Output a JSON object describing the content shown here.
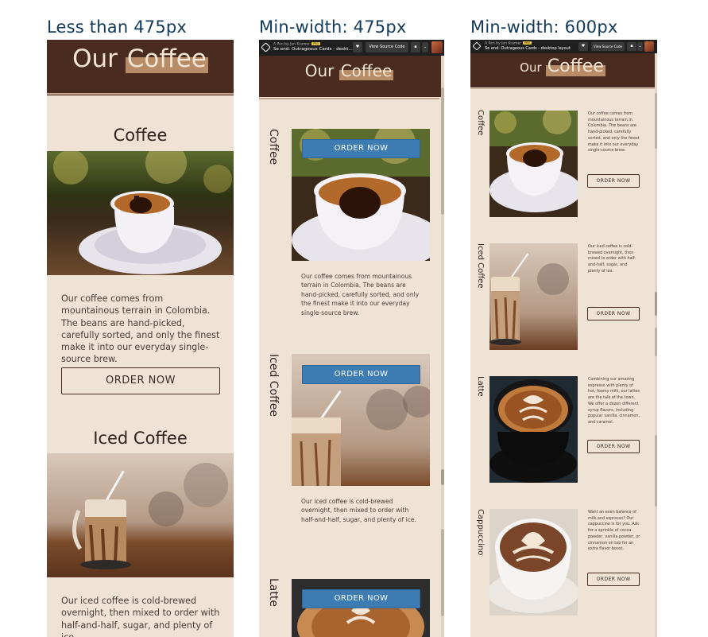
{
  "titles": {
    "col1": "Less than 475px",
    "col2": "Min-width: 475px",
    "col3": "Min-width: 600px"
  },
  "site": {
    "logo_our": "Our",
    "logo_coffee": "Coffee"
  },
  "codepen": {
    "p2": {
      "author": "A Pen by Jen Kramer",
      "pro": "PRO",
      "title": "Se end: Outrageous Cards - deskt...",
      "source": "View Source Code"
    },
    "p3": {
      "author": "A Pen by Jen Kramer",
      "pro": "PRO",
      "title": "Se end: Outrageous Cards - desktop layout",
      "source": "View Source Code"
    }
  },
  "cards": [
    {
      "title": "Coffee",
      "text": "Our coffee comes from mountainous terrain in Colombia. The beans are hand-picked, carefully sorted, and only the finest make it into our everyday single-source brew.",
      "button": "ORDER NOW"
    },
    {
      "title": "Iced Coffee",
      "text": "Our iced coffee is cold-brewed overnight, then mixed to order with half-and-half, sugar, and plenty of ice.",
      "button": "ORDER NOW"
    },
    {
      "title": "Latte",
      "text": "Combining our amazing espresso with plenty of hot, foamy milk, our lattes are the talk of the town. We offer a dozen different syrup flavors, including popular vanilla, cinnamon, and caramel.",
      "button": "ORDER NOW"
    },
    {
      "title": "Cappuccino",
      "text": "Want an even balance of milk and espresso? Our cappuccino is for you. Ask for a sprinkle of cocoa powder, vanilla powder, or cinnamon on top for an extra flavor boost.",
      "button": "ORDER NOW"
    }
  ],
  "colors": {
    "header": "#4a2b20",
    "panel_bg": "#efe3d6",
    "accent_blue": "#3d7bb3",
    "title_blue": "#123a5a"
  }
}
